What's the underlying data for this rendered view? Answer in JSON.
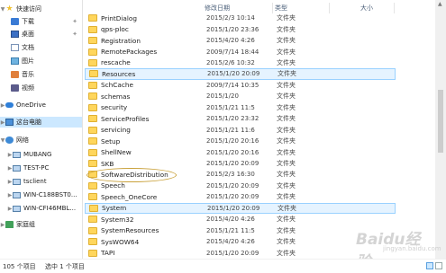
{
  "nav": {
    "quick_access": "快速访问",
    "items": [
      {
        "label": "下载",
        "pinned": true
      },
      {
        "label": "桌面",
        "pinned": true
      },
      {
        "label": "文档"
      },
      {
        "label": "图片"
      },
      {
        "label": "音乐"
      },
      {
        "label": "视频"
      }
    ],
    "onedrive": "OneDrive",
    "this_pc": "这台电脑",
    "network": "网络",
    "computers": [
      "MUBANG",
      "TEST-PC",
      "tsclient",
      "WIN-C188BST0...",
      "WIN-CFI46MBL..."
    ],
    "homegroup": "家庭组"
  },
  "columns": {
    "date": "修改日期",
    "type": "类型",
    "size": "大小"
  },
  "files": [
    {
      "name": "PrintDialog",
      "date": "2015/2/3 10:14",
      "type": "文件夹"
    },
    {
      "name": "qps-ploc",
      "date": "2015/1/20 23:36",
      "type": "文件夹"
    },
    {
      "name": "Registration",
      "date": "2015/4/20 4:26",
      "type": "文件夹"
    },
    {
      "name": "RemotePackages",
      "date": "2009/7/14 18:44",
      "type": "文件夹"
    },
    {
      "name": "rescache",
      "date": "2015/2/6 10:32",
      "type": "文件夹"
    },
    {
      "name": "Resources",
      "date": "2015/1/20 20:09",
      "type": "文件夹",
      "highlight": true
    },
    {
      "name": "SchCache",
      "date": "2009/7/14 10:35",
      "type": "文件夹"
    },
    {
      "name": "schemas",
      "date": "2015/1/20",
      "type": "文件夹"
    },
    {
      "name": "security",
      "date": "2015/1/21 11:5",
      "type": "文件夹"
    },
    {
      "name": "ServiceProfiles",
      "date": "2015/1/20 23:32",
      "type": "文件夹"
    },
    {
      "name": "servicing",
      "date": "2015/1/21 11:6",
      "type": "文件夹"
    },
    {
      "name": "Setup",
      "date": "2015/1/20 20:16",
      "type": "文件夹"
    },
    {
      "name": "ShellNew",
      "date": "2015/1/20 20:16",
      "type": "文件夹"
    },
    {
      "name": "SKB",
      "date": "2015/1/20 20:09",
      "type": "文件夹"
    },
    {
      "name": "SoftwareDistribution",
      "date": "2015/2/3 16:30",
      "type": "文件夹"
    },
    {
      "name": "Speech",
      "date": "2015/1/20 20:09",
      "type": "文件夹"
    },
    {
      "name": "Speech_OneCore",
      "date": "2015/1/20 20:09",
      "type": "文件夹"
    },
    {
      "name": "System",
      "date": "2015/1/20 20:09",
      "type": "文件夹",
      "highlight": true
    },
    {
      "name": "System32",
      "date": "2015/4/20 4:26",
      "type": "文件夹"
    },
    {
      "name": "SystemResources",
      "date": "2015/1/21 11:5",
      "type": "文件夹"
    },
    {
      "name": "SysWOW64",
      "date": "2015/4/20 4:26",
      "type": "文件夹"
    },
    {
      "name": "TAPI",
      "date": "2015/1/20 20:09",
      "type": "文件夹"
    }
  ],
  "status": {
    "count": "105 个项目",
    "selected": "选中 1 个项目"
  },
  "watermark": {
    "brand": "Baidu经验",
    "sub": "jingyan.baidu.com"
  }
}
